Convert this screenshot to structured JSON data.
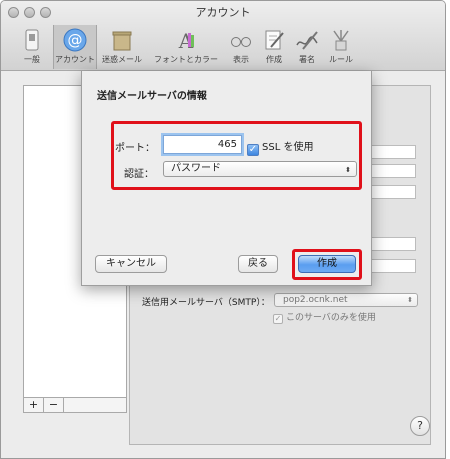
{
  "window": {
    "title": "アカウント"
  },
  "toolbar": {
    "items": [
      {
        "label": "一般",
        "icon": "switch-icon"
      },
      {
        "label": "アカウント",
        "icon": "at-sign-icon"
      },
      {
        "label": "迷惑メール",
        "icon": "trash-bin-icon"
      },
      {
        "label": "フォントとカラー",
        "icon": "font-color-icon"
      },
      {
        "label": "表示",
        "icon": "glasses-icon"
      },
      {
        "label": "作成",
        "icon": "compose-icon"
      },
      {
        "label": "署名",
        "icon": "signature-icon"
      },
      {
        "label": "ルール",
        "icon": "rules-icon"
      }
    ]
  },
  "accounts_list": {
    "add_label": "+",
    "remove_label": "−"
  },
  "smtp": {
    "label": "送信用メールサーバ（SMTP）：",
    "value": "pop2.ocnk.net",
    "only_server_label": "このサーバのみを使用"
  },
  "help": {
    "label": "?"
  },
  "dialog": {
    "title": "送信メールサーバの情報",
    "port_label": "ポート：",
    "port_value": "465",
    "ssl_label": "SSL を使用",
    "auth_label": "認証：",
    "auth_value": "パスワード",
    "cancel_label": "キャンセル",
    "back_label": "戻る",
    "create_label": "作成"
  },
  "colors": {
    "highlight": "#e0101a",
    "primary_button": "#5a9ef0"
  }
}
